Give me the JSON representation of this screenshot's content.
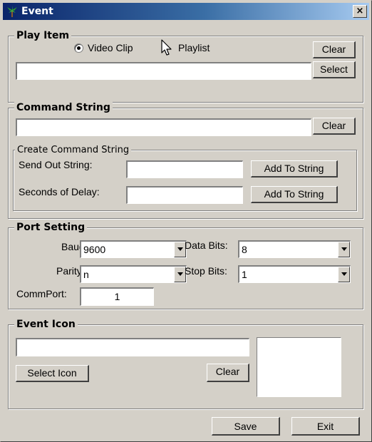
{
  "window": {
    "title": "Event",
    "close_glyph": "×"
  },
  "play_item": {
    "group_label": "Play Item",
    "radio_video_label": "Video Clip",
    "radio_playlist_label": "Playlist",
    "selected_option": "Video Clip",
    "path_value": "",
    "clear_label": "Clear",
    "select_label": "Select"
  },
  "command_string": {
    "group_label": "Command String",
    "value": "",
    "clear_label": "Clear",
    "create": {
      "group_label": "Create Command String",
      "send_out_label": "Send Out String:",
      "send_out_value": "",
      "delay_label": "Seconds of Delay:",
      "delay_value": "",
      "add_label_1": "Add To String",
      "add_label_2": "Add To String"
    }
  },
  "port_setting": {
    "group_label": "Port Setting",
    "baud_label": "Baud:",
    "baud_value": "9600",
    "data_bits_label": "Data Bits:",
    "data_bits_value": "8",
    "parity_label": "Parity:",
    "parity_value": "n",
    "stop_bits_label": "Stop Bits:",
    "stop_bits_value": "1",
    "comm_port_label": "CommPort:",
    "comm_port_value": "1"
  },
  "event_icon": {
    "group_label": "Event Icon",
    "path_value": "",
    "select_icon_label": "Select Icon",
    "clear_label": "Clear"
  },
  "footer": {
    "save_label": "Save",
    "exit_label": "Exit"
  },
  "icons": [
    "app-palm-icon",
    "close-icon",
    "mouse-cursor-icon",
    "dropdown-arrow-icon"
  ],
  "colors": {
    "titlebar_start": "#0a246a",
    "titlebar_end": "#a6caf0",
    "face": "#d4d0c8"
  }
}
